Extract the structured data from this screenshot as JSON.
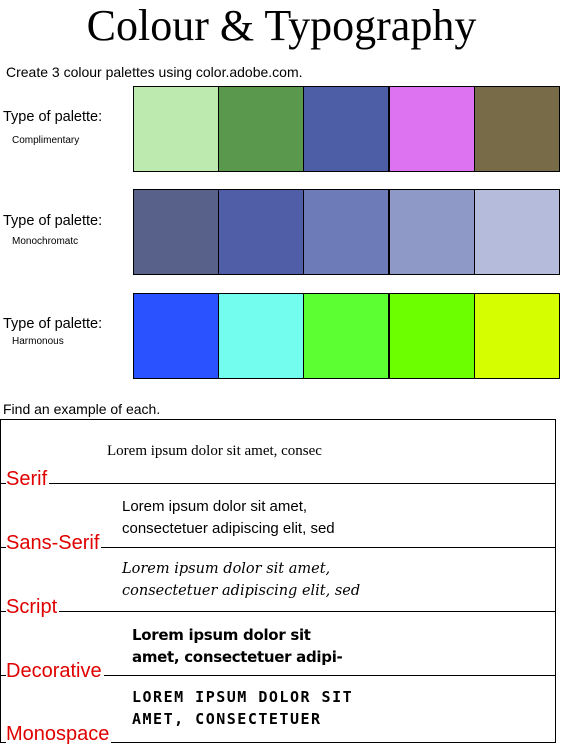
{
  "title": "Colour & Typography",
  "instruction": "Create 3 colour palettes using color.adobe.com.",
  "palettes": [
    {
      "label": "Type of palette:",
      "type": "Complimentary",
      "colors": [
        "#bdebaf",
        "#5a994d",
        "#4d5da6",
        "#dd73f0",
        "#786b48"
      ]
    },
    {
      "label": "Type of palette:",
      "type": "Monochromatc",
      "colors": [
        "#58618a",
        "#4f5ea6",
        "#6d7bb8",
        "#8e99c8",
        "#b5bcdb"
      ]
    },
    {
      "label": "Type of palette:",
      "type": "Harmonous",
      "colors": [
        "#2a52ff",
        "#73fdee",
        "#5cff32",
        "#6bff00",
        "#d5ff00"
      ]
    }
  ],
  "find_label": "Find an example of each.",
  "fonts": [
    {
      "name": "Serif",
      "line1": "Lorem ipsum dolor sit amet, consec",
      "line2": ""
    },
    {
      "name": "Sans-Serif",
      "line1": "Lorem ipsum dolor sit amet,",
      "line2": "consectetuer adipiscing elit, sed"
    },
    {
      "name": "Script",
      "line1": "Lorem ipsum dolor sit amet,",
      "line2": "consectetuer adipiscing elit, sed"
    },
    {
      "name": "Decorative",
      "line1": "Lorem ipsum dolor sit",
      "line2": "amet, consectetuer adipi-"
    },
    {
      "name": "Monospace",
      "line1": "LOREM IPSUM DOLOR SIT",
      "line2": "AMET, CONSECTETUER"
    }
  ],
  "accent_color": "#e00000"
}
